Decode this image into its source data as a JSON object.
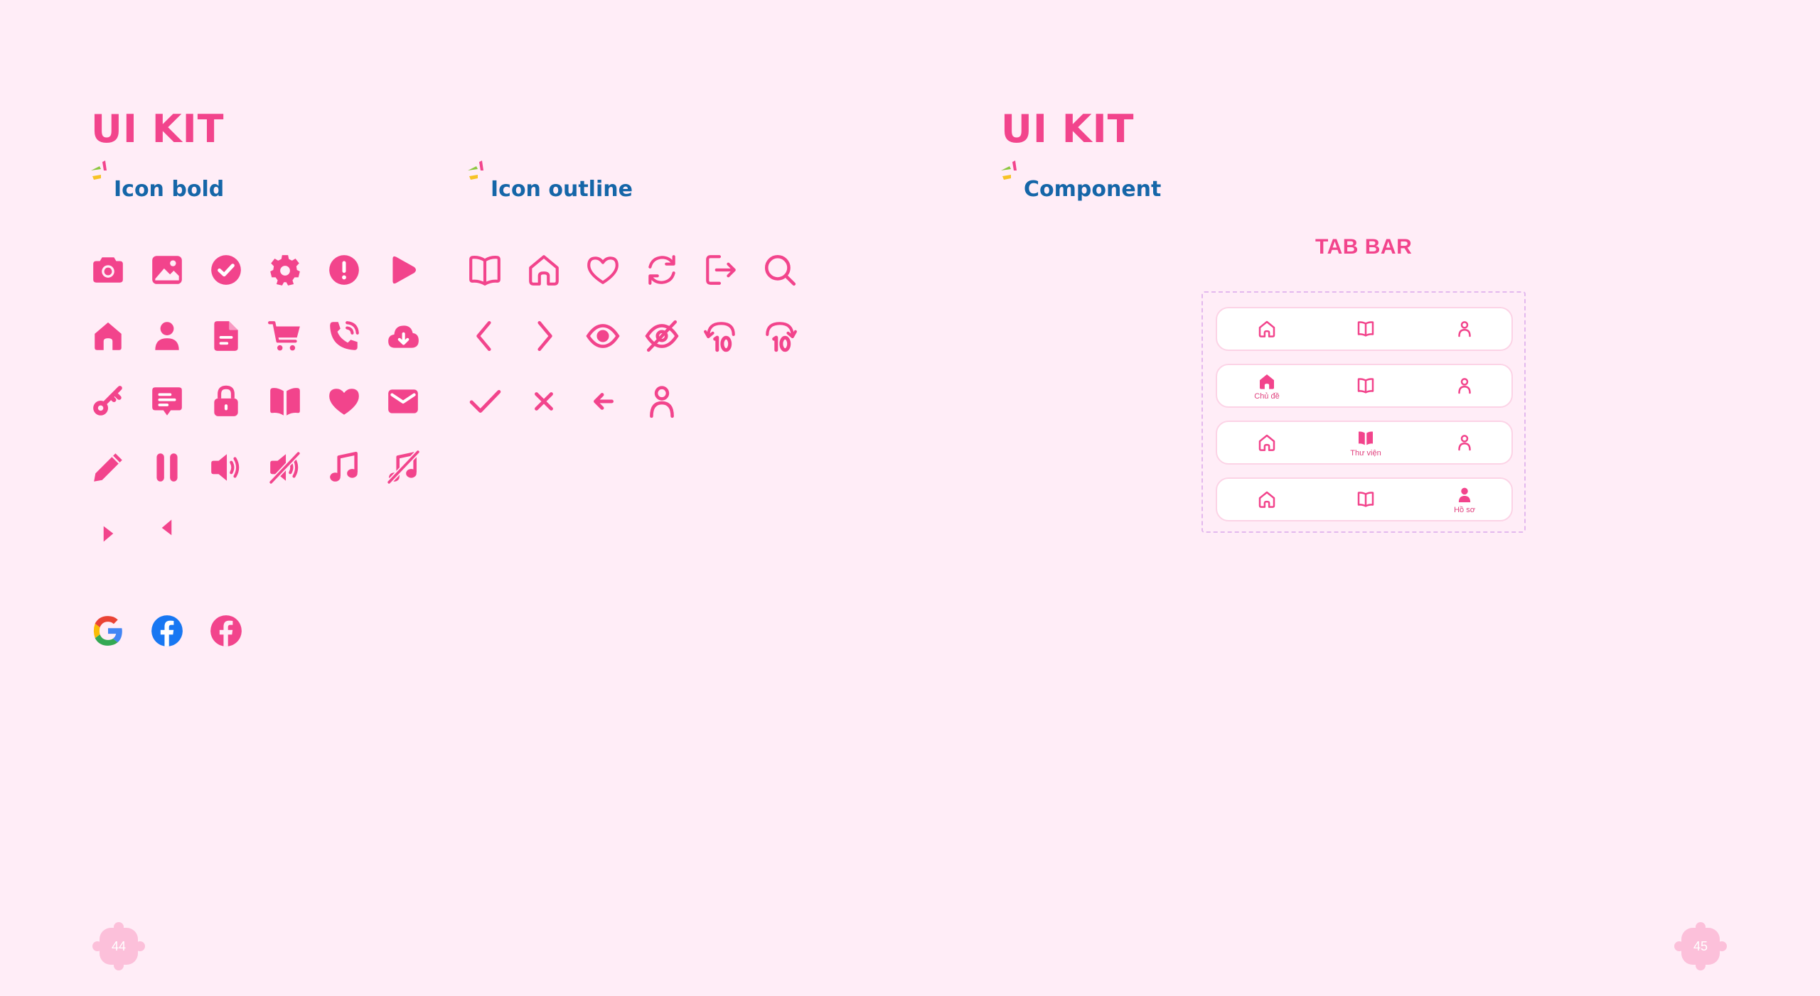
{
  "left_page": {
    "title": "UI KIT",
    "sections": {
      "icon_bold": "Icon bold",
      "icon_outline": "Icon outline"
    },
    "page_number": "44"
  },
  "right_page": {
    "title": "UI KIT",
    "section": "Component",
    "tab_bar_title": "TAB BAR",
    "tab_labels": {
      "topics": "Chủ đề",
      "library": "Thư viện",
      "profile": "Hồ sơ"
    },
    "page_number": "45"
  },
  "bold_icons": [
    "camera-icon",
    "image-icon",
    "check-circle-icon",
    "gear-icon",
    "alert-icon",
    "play-icon",
    "home-icon",
    "user-icon",
    "document-icon",
    "cart-icon",
    "phone-ringing-icon",
    "cloud-download-icon",
    "key-icon",
    "message-icon",
    "lock-icon",
    "book-icon",
    "heart-icon",
    "mail-icon",
    "pencil-icon",
    "pause-icon",
    "volume-icon",
    "volume-mute-icon",
    "music-icon",
    "music-off-icon",
    "caret-right-icon",
    "caret-left-icon"
  ],
  "outline_icons": [
    "book-icon",
    "home-icon",
    "heart-icon",
    "refresh-icon",
    "logout-icon",
    "search-icon",
    "chevron-left-icon",
    "chevron-right-icon",
    "eye-icon",
    "eye-off-icon",
    "rewind-10-icon",
    "forward-10-icon",
    "check-icon",
    "close-icon",
    "arrow-left-icon",
    "user-icon"
  ],
  "social_icons": [
    "google-icon",
    "facebook-icon",
    "facebook-pink-icon"
  ],
  "colors": {
    "background": "#FFEDF7",
    "accent_pink": "#F2448C",
    "heading_blue": "#1566A8",
    "facebook_blue": "#1877F2"
  }
}
